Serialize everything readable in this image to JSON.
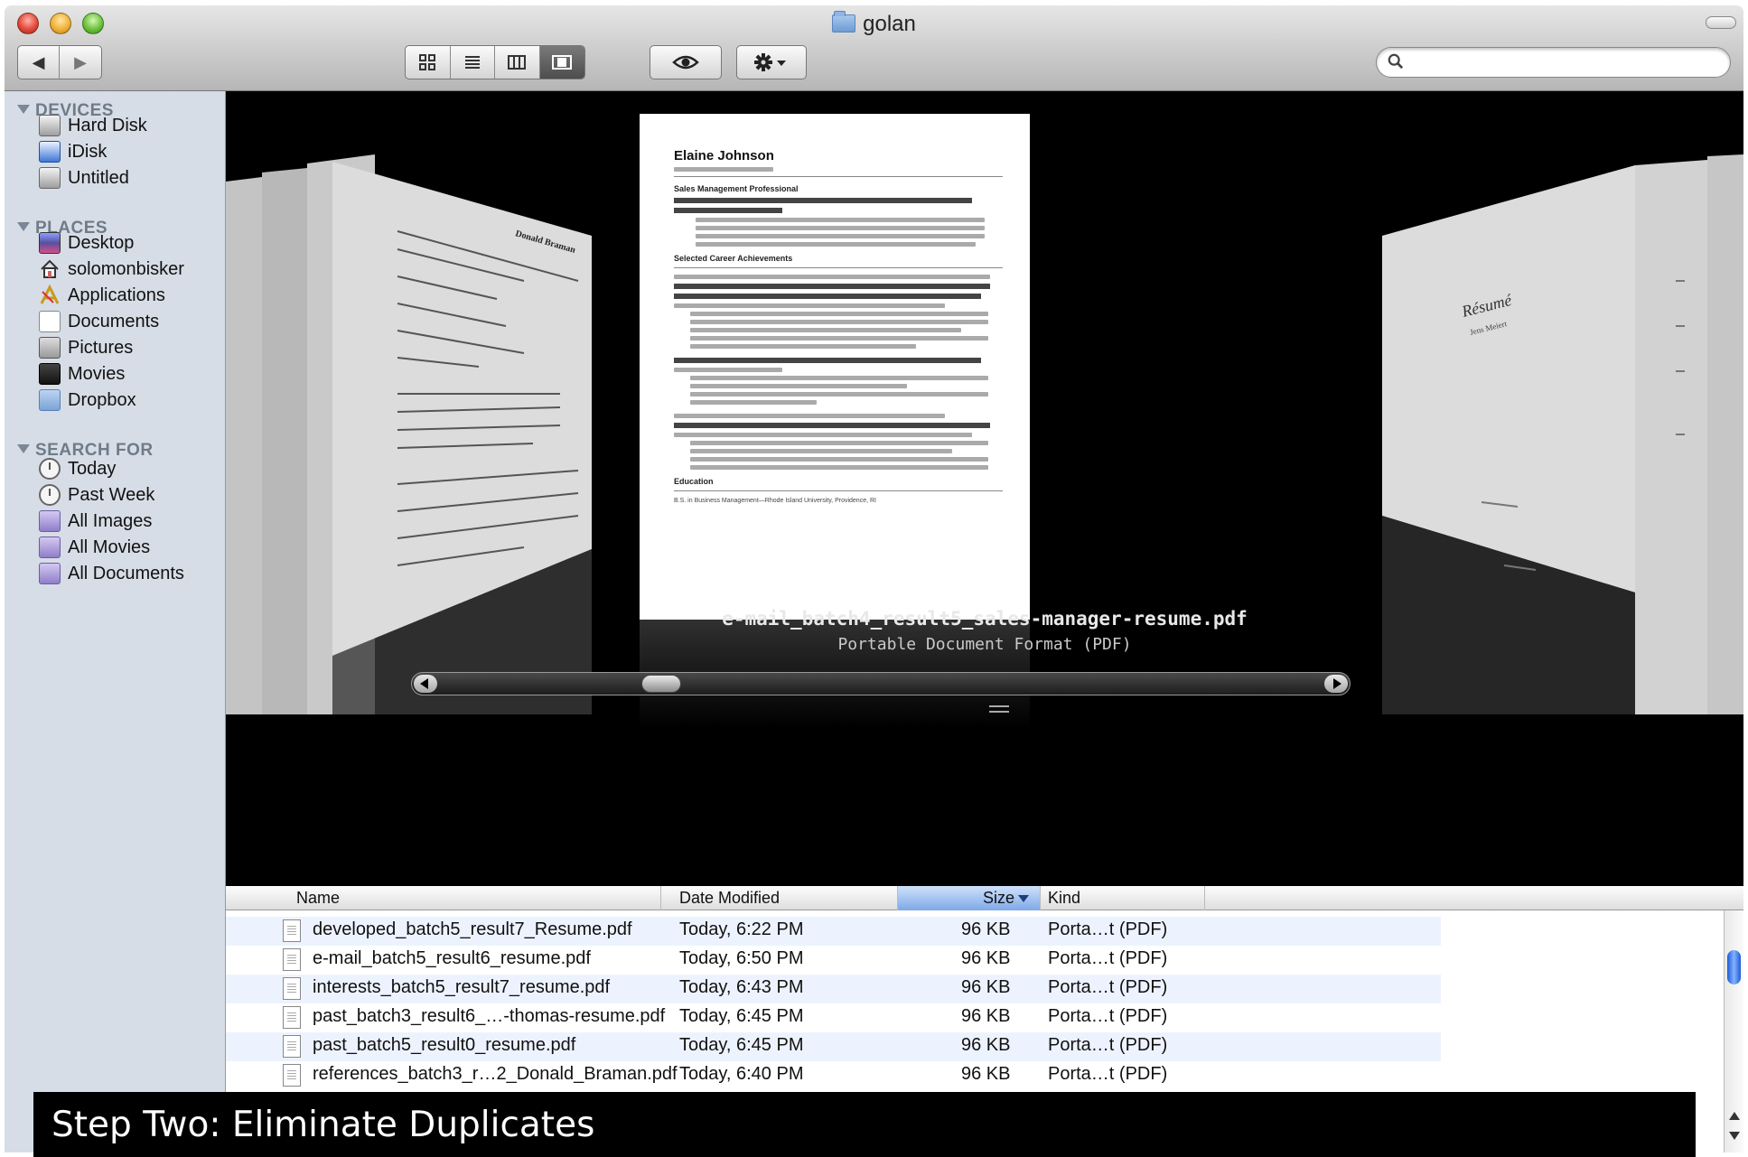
{
  "window": {
    "title": "golan"
  },
  "toolbar": {
    "nav": [
      "◀",
      "▶"
    ],
    "views": [
      "icon-view",
      "list-view",
      "column-view",
      "coverflow-view"
    ],
    "active_view": "coverflow-view",
    "search_placeholder": ""
  },
  "sidebar": {
    "devices": {
      "heading": "DEVICES",
      "items": [
        {
          "label": "Hard Disk",
          "icon": "hard-disk-icon"
        },
        {
          "label": "iDisk",
          "icon": "idisk-icon"
        },
        {
          "label": "Untitled",
          "icon": "disk-icon"
        }
      ]
    },
    "places": {
      "heading": "PLACES",
      "items": [
        {
          "label": "Desktop",
          "icon": "desktop-icon"
        },
        {
          "label": "solomonbisker",
          "icon": "home-icon"
        },
        {
          "label": "Applications",
          "icon": "applications-icon"
        },
        {
          "label": "Documents",
          "icon": "documents-icon"
        },
        {
          "label": "Pictures",
          "icon": "pictures-icon"
        },
        {
          "label": "Movies",
          "icon": "movies-icon"
        },
        {
          "label": "Dropbox",
          "icon": "folder-icon"
        }
      ]
    },
    "search_for": {
      "heading": "SEARCH FOR",
      "items": [
        {
          "label": "Today",
          "icon": "clock-icon"
        },
        {
          "label": "Past Week",
          "icon": "clock-icon"
        },
        {
          "label": "All Images",
          "icon": "smart-folder-icon"
        },
        {
          "label": "All Movies",
          "icon": "smart-folder-icon"
        },
        {
          "label": "All Documents",
          "icon": "smart-folder-icon"
        }
      ]
    }
  },
  "coverflow": {
    "selected_title": "e-mail_batch4_result5_sales-manager-resume.pdf",
    "selected_kind": "Portable Document Format (PDF)",
    "preview": {
      "name": "Elaine Johnson",
      "section1": "Sales Management Professional",
      "section2": "Selected Career Achievements",
      "section3": "Education",
      "edu": "B.S. in Business Management—Rhode Island University, Providence, RI"
    },
    "left_page": {
      "name": "Donald Braman"
    },
    "right_page": {
      "title": "Résumé",
      "name": "Jens Meiert"
    },
    "scroll_position": 0.24
  },
  "list": {
    "columns": {
      "name": "Name",
      "date": "Date Modified",
      "size": "Size",
      "kind": "Kind"
    },
    "sorted_column": "Size",
    "rows": [
      {
        "name": "developed_batch5_result7_Resume.pdf",
        "date": "Today, 6:22 PM",
        "size": "96 KB",
        "kind": "Porta…t (PDF)"
      },
      {
        "name": "e-mail_batch5_result6_resume.pdf",
        "date": "Today, 6:50 PM",
        "size": "96 KB",
        "kind": "Porta…t (PDF)"
      },
      {
        "name": "interests_batch5_result7_resume.pdf",
        "date": "Today, 6:43 PM",
        "size": "96 KB",
        "kind": "Porta…t (PDF)"
      },
      {
        "name": "past_batch3_result6_…-thomas-resume.pdf",
        "date": "Today, 6:45 PM",
        "size": "96 KB",
        "kind": "Porta…t (PDF)"
      },
      {
        "name": "past_batch5_result0_resume.pdf",
        "date": "Today, 6:45 PM",
        "size": "96 KB",
        "kind": "Porta…t (PDF)"
      },
      {
        "name": "references_batch3_r…2_Donald_Braman.pdf",
        "date": "Today, 6:40 PM",
        "size": "96 KB",
        "kind": "Porta…t (PDF)"
      }
    ]
  },
  "caption": {
    "text": "Step Two: Eliminate Duplicates"
  },
  "colors": {
    "sidebar_bg": "#d7dde6",
    "coverflow_bg": "#000000",
    "sort_header": "#7fa9e8",
    "alt_row": "#edf3fe"
  }
}
